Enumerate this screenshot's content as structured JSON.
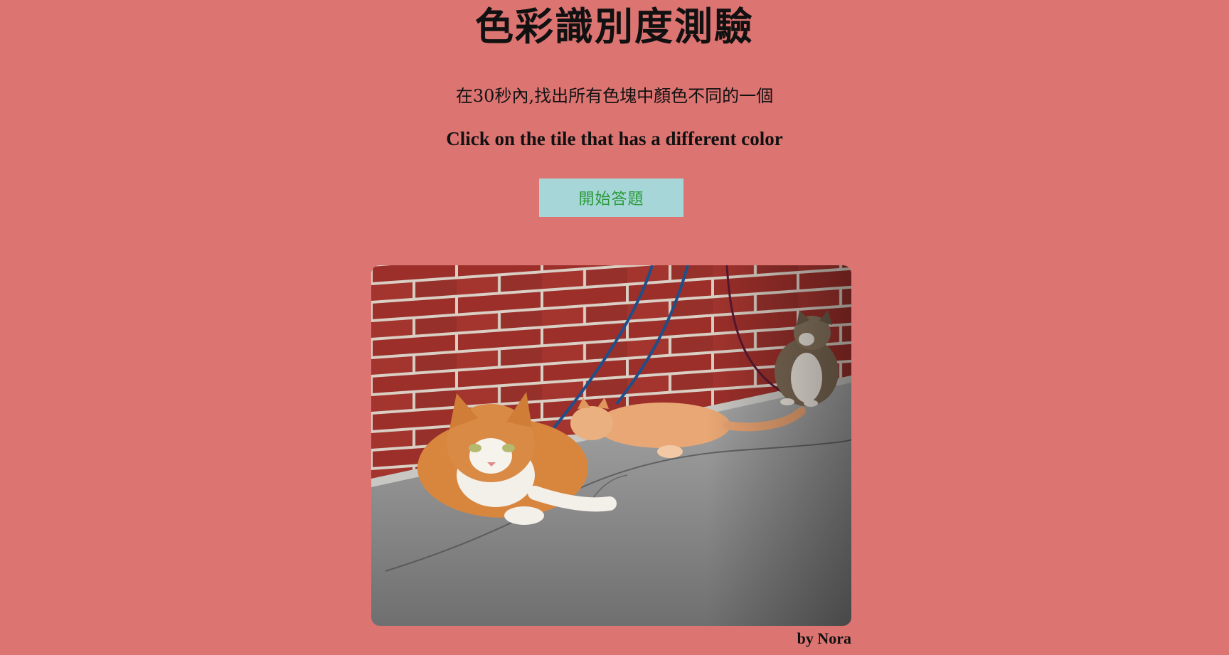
{
  "page": {
    "title": "色彩識別度測驗",
    "instruction_zh": "在30秒內,找出所有色塊中顏色不同的一個",
    "instruction_en": "Click on the tile that has a different color",
    "start_button_label": "開始答題",
    "photo_description": "three cats on pavement beside brick wall",
    "credit": "by Nora"
  },
  "colors": {
    "background": "#dc7472",
    "button_bg": "#a6d6d8",
    "button_text": "#2a9a3a"
  }
}
